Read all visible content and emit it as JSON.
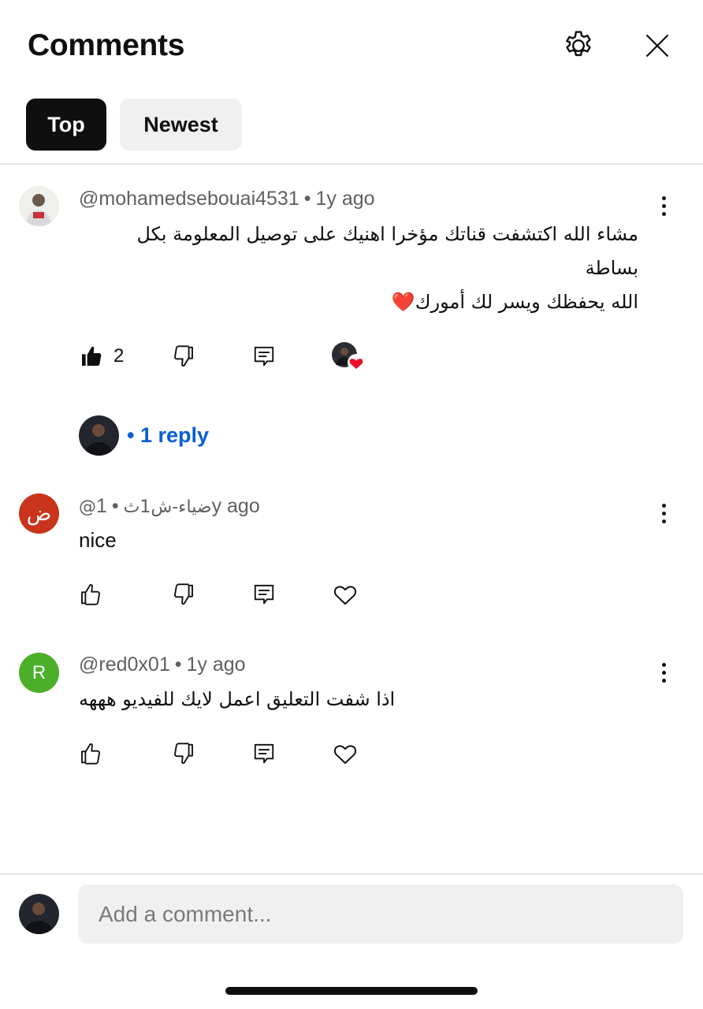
{
  "header": {
    "title": "Comments"
  },
  "chips": [
    {
      "label": "Top",
      "active": true
    },
    {
      "label": "Newest",
      "active": false
    }
  ],
  "comments": [
    {
      "author": "@mohamedsebouai4531",
      "time": "1y ago",
      "lines": [
        "مشاء الله اكتشفت قناتك مؤخرا اهنيك على توصيل المعلومة بكل",
        "بساطة",
        "الله يحفظك ويسر لك أمورك❤️"
      ],
      "likes": "2",
      "liked": true,
      "creator_hearted": true,
      "replies": "1 reply"
    },
    {
      "author": "@ضياء-ش1ث",
      "time": "1y ago",
      "avatar_letter": "ض",
      "avatar_color": "#c9341c",
      "text": "nice"
    },
    {
      "author": "@red0x01",
      "time": "1y ago",
      "avatar_letter": "R",
      "avatar_color": "#4caf2a",
      "text": "اذا شفت التعليق اعمل لايك للفيديو هههه"
    }
  ],
  "composer": {
    "placeholder": "Add a comment..."
  },
  "colors": {
    "reply_link": "#065fd4",
    "chip_active_bg": "#0f0f0f",
    "chip_inactive_bg": "#f0f0f0",
    "heart": "#e8102a"
  },
  "icons": {
    "settings": "gear-icon",
    "close": "close-icon",
    "like": "thumbs-up-icon",
    "dislike": "thumbs-down-icon",
    "reply": "reply-icon",
    "heart": "heart-icon",
    "more": "more-vert-icon"
  }
}
